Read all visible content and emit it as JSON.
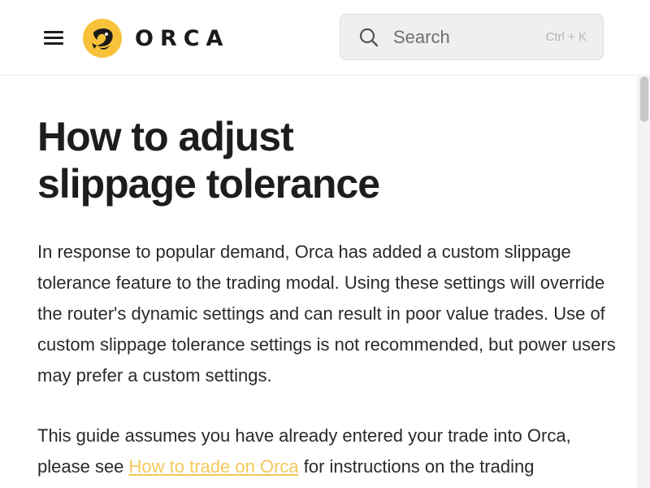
{
  "header": {
    "menu_icon": "hamburger-menu-icon",
    "logo_icon": "orca-whale-logo-icon",
    "logo_text": "ORCA",
    "colors": {
      "logo_circle": "#f7c23a",
      "logo_mark": "#1a1a1a"
    }
  },
  "search": {
    "icon": "search-icon",
    "placeholder": "Search",
    "shortcut": "Ctrl + K"
  },
  "article": {
    "title_line1": "How to adjust",
    "title_line2": "slippage tolerance",
    "paragraph1": "In response to popular demand, Orca has added a custom slippage tolerance feature to the trading modal. Using these settings will override the router's dynamic settings and can result in poor value trades. Use of custom slippage tolerance settings is not recommended, but power users may prefer a custom settings.",
    "paragraph2_before": "This guide assumes you have already entered your trade into Orca, please see ",
    "paragraph2_link": "How to trade on Orca",
    "paragraph2_after": " for instructions on the trading",
    "colors": {
      "link": "#f4c95b"
    }
  }
}
